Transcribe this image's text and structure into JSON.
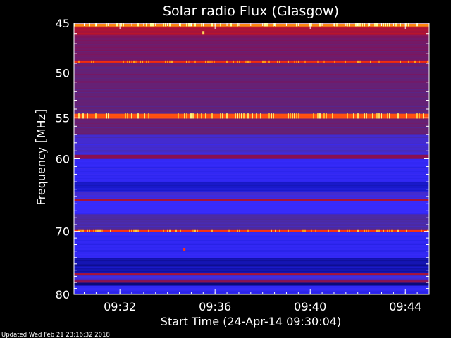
{
  "chart_data": {
    "type": "heatmap",
    "title": "Solar radio Flux (Glasgow)",
    "xlabel": "Start Time (24-Apr-14 09:30:04)",
    "ylabel_main": "Frequency ",
    "ylabel_unit": "MHz",
    "footer": "Updated Wed Feb 21 23:16:32 2018",
    "x_range_minutes": [
      0,
      14.93
    ],
    "x_tick_minutes": [
      1.93,
      5.93,
      9.93,
      13.93
    ],
    "x_tick_labels": [
      "09:32",
      "09:36",
      "09:40",
      "09:44"
    ],
    "y_range_mhz": [
      45,
      80
    ],
    "y_ticks_mhz": [
      45,
      50,
      55,
      60,
      70,
      80
    ],
    "y_tick_labels": [
      "45",
      "50",
      "55",
      "60",
      "70",
      "80"
    ],
    "colormap": [
      "#000040",
      "#1a1ad0",
      "#3a2cff",
      "#502a8a",
      "#8a1050",
      "#d01818",
      "#ff3a10",
      "#ff9a10",
      "#ffff90"
    ],
    "bands": [
      {
        "from_mhz": 45.0,
        "to_mhz": 45.3,
        "level": 0.85
      },
      {
        "from_mhz": 45.3,
        "to_mhz": 46.2,
        "level": 0.55
      },
      {
        "from_mhz": 46.2,
        "to_mhz": 48.7,
        "level": 0.45
      },
      {
        "from_mhz": 48.7,
        "to_mhz": 49.0,
        "level": 0.68
      },
      {
        "from_mhz": 49.0,
        "to_mhz": 54.5,
        "level": 0.42
      },
      {
        "from_mhz": 54.5,
        "to_mhz": 55.1,
        "level": 0.78
      },
      {
        "from_mhz": 55.1,
        "to_mhz": 57.0,
        "level": 0.42
      },
      {
        "from_mhz": 57.0,
        "to_mhz": 59.5,
        "level": 0.3
      },
      {
        "from_mhz": 59.5,
        "to_mhz": 60.0,
        "level": 0.5
      },
      {
        "from_mhz": 60.0,
        "to_mhz": 63.0,
        "level": 0.22
      },
      {
        "from_mhz": 63.0,
        "to_mhz": 64.3,
        "level": 0.12
      },
      {
        "from_mhz": 64.3,
        "to_mhz": 65.3,
        "level": 0.3
      },
      {
        "from_mhz": 65.3,
        "to_mhz": 65.6,
        "level": 0.55
      },
      {
        "from_mhz": 65.6,
        "to_mhz": 67.5,
        "level": 0.24
      },
      {
        "from_mhz": 67.5,
        "to_mhz": 69.7,
        "level": 0.35
      },
      {
        "from_mhz": 69.7,
        "to_mhz": 70.1,
        "level": 0.72
      },
      {
        "from_mhz": 70.1,
        "to_mhz": 74.0,
        "level": 0.22
      },
      {
        "from_mhz": 74.0,
        "to_mhz": 76.5,
        "level": 0.1
      },
      {
        "from_mhz": 76.5,
        "to_mhz": 76.8,
        "level": 0.55
      },
      {
        "from_mhz": 76.8,
        "to_mhz": 77.5,
        "level": 0.28
      },
      {
        "from_mhz": 77.5,
        "to_mhz": 78.0,
        "level": 0.48
      },
      {
        "from_mhz": 78.0,
        "to_mhz": 78.5,
        "level": 0.05
      },
      {
        "from_mhz": 78.5,
        "to_mhz": 80.0,
        "level": 0.22
      }
    ],
    "bursts": [
      {
        "t_min": 5.44,
        "f_mhz": 45.9,
        "level": 0.95
      },
      {
        "t_min": 4.64,
        "f_mhz": 72.7,
        "level": 0.75
      }
    ]
  }
}
